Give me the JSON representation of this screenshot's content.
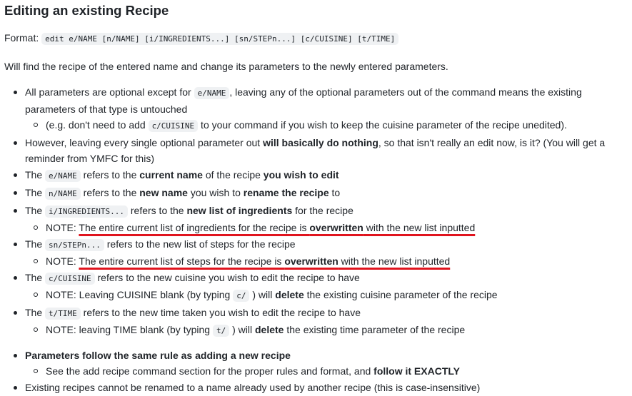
{
  "heading": "Editing an existing Recipe",
  "format": {
    "label": "Format:",
    "code": "edit e/NAME [n/NAME] [i/INGREDIENTS...] [sn/STEPn...] [c/CUISINE] [t/TIME]"
  },
  "description": "Will find the recipe of the entered name and change its parameters to the newly entered parameters.",
  "bullets": {
    "b1": {
      "t1": "All parameters are optional except for ",
      "code": "e/NAME",
      "t2": ", leaving any of the optional parameters out of the command means the existing parameters of that type is untouched",
      "sub": {
        "t1": "(e.g. don't need to add ",
        "code": "c/CUISINE",
        "t2": " to your command if you wish to keep the cuisine parameter of the recipe unedited)."
      }
    },
    "b2": {
      "t1": "However, leaving every single optional parameter out ",
      "b1": "will basically do nothing",
      "t2": ", so that isn't really an edit now, is it? (You will get a reminder from YMFC for this)"
    },
    "b3": {
      "t1": "The ",
      "code": "e/NAME",
      "t2": " refers to the ",
      "b1": "current name",
      "t3": " of the recipe ",
      "b2": "you wish to edit"
    },
    "b4": {
      "t1": "The ",
      "code": "n/NAME",
      "t2": " refers to the ",
      "b1": "new name",
      "t3": " you wish to ",
      "b2": "rename the recipe",
      "t4": " to"
    },
    "b5": {
      "t1": "The ",
      "code": "i/INGREDIENTS...",
      "t2": " refers to the ",
      "b1": "new list of ingredients",
      "t3": " for the recipe",
      "sub": {
        "t1": "NOTE: ",
        "t2": "The entire current list of ingredients for the recipe is ",
        "b1": "overwritten",
        "t3": " with the new list inputted"
      }
    },
    "b6": {
      "t1": "The ",
      "code": "sn/STEPn...",
      "t2": " refers to the new list of steps for the recipe",
      "sub": {
        "t1": "NOTE: ",
        "t2": "The entire current list of steps for the recipe is ",
        "b1": "overwritten",
        "t3": " with the new list inputted"
      }
    },
    "b7": {
      "t1": "The ",
      "code": "c/CUISINE",
      "t2": " refers to the new cuisine you wish to edit the recipe to have",
      "sub": {
        "t1": "NOTE: Leaving CUISINE blank (by typing ",
        "code": "c/",
        "t2": " ) will ",
        "b1": "delete",
        "t3": " the existing cuisine parameter of the recipe"
      }
    },
    "b8": {
      "t1": "The ",
      "code": "t/TIME",
      "t2": " refers to the new time taken you wish to edit the recipe to have",
      "sub": {
        "t1": "NOTE: leaving TIME blank (by typing ",
        "code": "t/",
        "t2": " ) will ",
        "b1": "delete",
        "t3": " the existing time parameter of the recipe"
      }
    },
    "b9": {
      "b1": "Parameters follow the same rule as adding a new recipe",
      "sub": {
        "t1": "See the add recipe command section for the proper rules and format, and ",
        "b1": "follow it EXACTLY"
      }
    },
    "b10": {
      "t1": "Existing recipes cannot be renamed to a name already used by another recipe (this is case-insensitive)"
    }
  },
  "annotation_color": "#e0141e"
}
